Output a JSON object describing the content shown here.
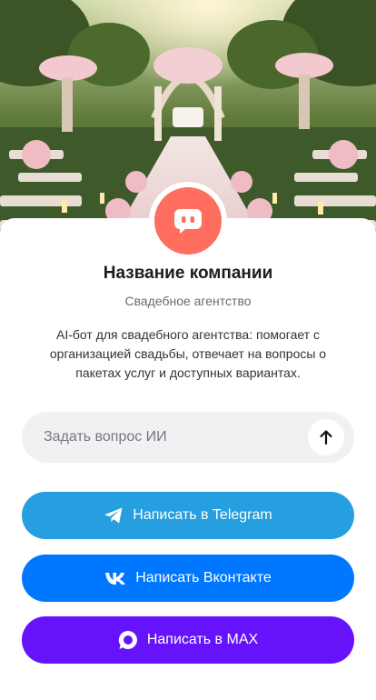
{
  "company": {
    "title": "Название компании",
    "subtitle": "Свадебное агентство",
    "description": "AI-бот для свадебного агентства: помогает с организацией свадьбы, отвечает на вопросы о пакетах услуг и доступных вариантах."
  },
  "ask": {
    "placeholder": "Задать вопрос ИИ",
    "value": ""
  },
  "actions": {
    "telegram_label": "Написать в Telegram",
    "vk_label": "Написать Вконтакте",
    "max_label": "Написать в MAX"
  },
  "colors": {
    "avatar": "#ff6e5e",
    "telegram": "#259fdf",
    "vk": "#0077ff",
    "max": "#6613fb"
  },
  "icons": {
    "avatar": "chat-bot-icon",
    "send": "arrow-up-icon",
    "telegram": "telegram-icon",
    "vk": "vk-icon",
    "max": "max-icon"
  }
}
